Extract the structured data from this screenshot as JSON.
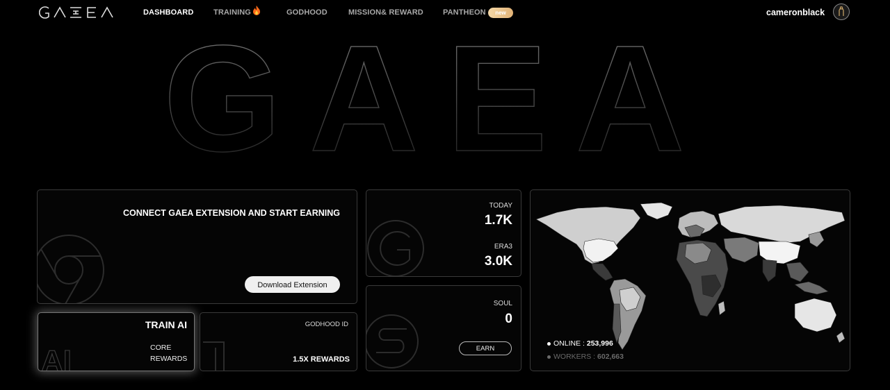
{
  "nav": {
    "logo_text": "GAEA",
    "items": [
      {
        "label": "DASHBOARD"
      },
      {
        "label": "TRAINING"
      },
      {
        "label": "GODHOOD"
      },
      {
        "label": "MISSION& REWARD"
      },
      {
        "label": "PANTHEON"
      }
    ],
    "badge": "new",
    "username": "cameronblack"
  },
  "hero": {
    "text": "GAEA"
  },
  "connect_card": {
    "title": "CONNECT GAEA EXTENSION AND START EARNING",
    "button": "Download Extension"
  },
  "train_card": {
    "title": "TRAIN AI",
    "subtitle_line1": "CORE",
    "subtitle_line2": "REWARDS",
    "bg_text": "AI"
  },
  "godhood_card": {
    "label": "GODHOOD ID",
    "rewards": "1.5X REWARDS"
  },
  "stats_card": {
    "today_label": "TODAY",
    "today_value": "1.7K",
    "era_label": "ERA3",
    "era_value": "3.0K"
  },
  "soul_card": {
    "label": "SOUL",
    "value": "0",
    "button": "EARN"
  },
  "map_card": {
    "online_label": "ONLINE :",
    "online_value": "253,996",
    "workers_label": "WORKERS :",
    "workers_value": "602,663"
  },
  "colors": {
    "background": "#000000",
    "card_border": "#3a3a3a",
    "badge_gradient_start": "#f5d9a8",
    "badge_gradient_end": "#e2b377"
  }
}
